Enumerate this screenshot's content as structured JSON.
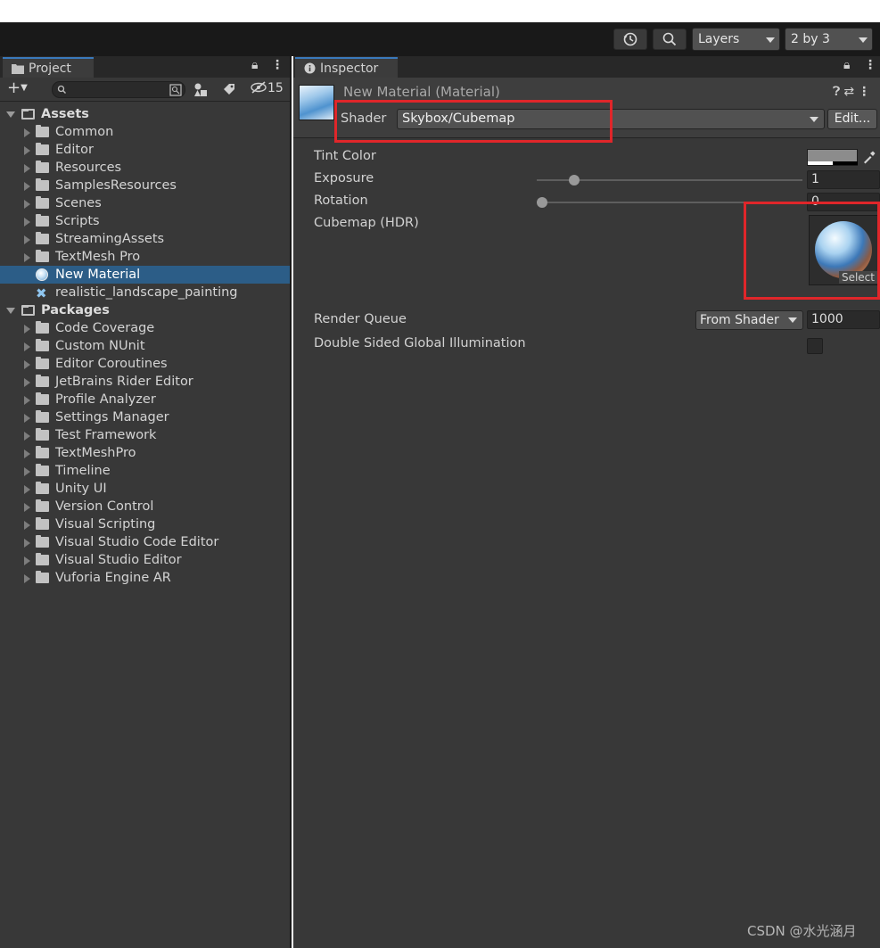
{
  "toolbar": {
    "layers_label": "Layers",
    "layout_label": "2 by 3"
  },
  "project": {
    "tab_label": "Project",
    "hidden_count": "15",
    "tree": [
      {
        "label": "Assets",
        "type": "root",
        "depth": 0
      },
      {
        "label": "Common",
        "type": "folder",
        "depth": 1
      },
      {
        "label": "Editor",
        "type": "folder",
        "depth": 1
      },
      {
        "label": "Resources",
        "type": "folder",
        "depth": 1
      },
      {
        "label": "SamplesResources",
        "type": "folder",
        "depth": 1
      },
      {
        "label": "Scenes",
        "type": "folder",
        "depth": 1
      },
      {
        "label": "Scripts",
        "type": "folder",
        "depth": 1
      },
      {
        "label": "StreamingAssets",
        "type": "folder",
        "depth": 1
      },
      {
        "label": "TextMesh Pro",
        "type": "folder",
        "depth": 1
      },
      {
        "label": "New Material",
        "type": "material",
        "depth": 1,
        "selected": true
      },
      {
        "label": "realistic_landscape_painting",
        "type": "texture",
        "depth": 1
      },
      {
        "label": "Packages",
        "type": "root",
        "depth": 0
      },
      {
        "label": "Code Coverage",
        "type": "folder",
        "depth": 1
      },
      {
        "label": "Custom NUnit",
        "type": "folder",
        "depth": 1
      },
      {
        "label": "Editor Coroutines",
        "type": "folder",
        "depth": 1
      },
      {
        "label": "JetBrains Rider Editor",
        "type": "folder",
        "depth": 1
      },
      {
        "label": "Profile Analyzer",
        "type": "folder",
        "depth": 1
      },
      {
        "label": "Settings Manager",
        "type": "folder",
        "depth": 1
      },
      {
        "label": "Test Framework",
        "type": "folder",
        "depth": 1
      },
      {
        "label": "TextMeshPro",
        "type": "folder",
        "depth": 1
      },
      {
        "label": "Timeline",
        "type": "folder",
        "depth": 1
      },
      {
        "label": "Unity UI",
        "type": "folder",
        "depth": 1
      },
      {
        "label": "Version Control",
        "type": "folder",
        "depth": 1
      },
      {
        "label": "Visual Scripting",
        "type": "folder",
        "depth": 1
      },
      {
        "label": "Visual Studio Code Editor",
        "type": "folder",
        "depth": 1
      },
      {
        "label": "Visual Studio Editor",
        "type": "folder",
        "depth": 1
      },
      {
        "label": "Vuforia Engine AR",
        "type": "folder",
        "depth": 1
      }
    ]
  },
  "inspector": {
    "tab_label": "Inspector",
    "material_title": "New Material (Material)",
    "shader_label": "Shader",
    "shader_value": "Skybox/Cubemap",
    "edit_button": "Edit...",
    "properties": {
      "tint_color_label": "Tint Color",
      "exposure_label": "Exposure",
      "exposure_value": "1",
      "exposure_slider": 0.14,
      "rotation_label": "Rotation",
      "rotation_value": "0",
      "rotation_slider": 0.0,
      "cubemap_label": "Cubemap   (HDR)",
      "cubemap_select": "Select",
      "render_queue_label": "Render Queue",
      "render_queue_mode": "From Shader",
      "render_queue_value": "1000",
      "double_sided_label": "Double Sided Global Illumination",
      "double_sided_checked": false
    }
  },
  "colors": {
    "selection": "#2c5d87",
    "highlight_box": "#e0262a",
    "tab_accent": "#3a79bb"
  },
  "watermark": "CSDN @水光涵月"
}
